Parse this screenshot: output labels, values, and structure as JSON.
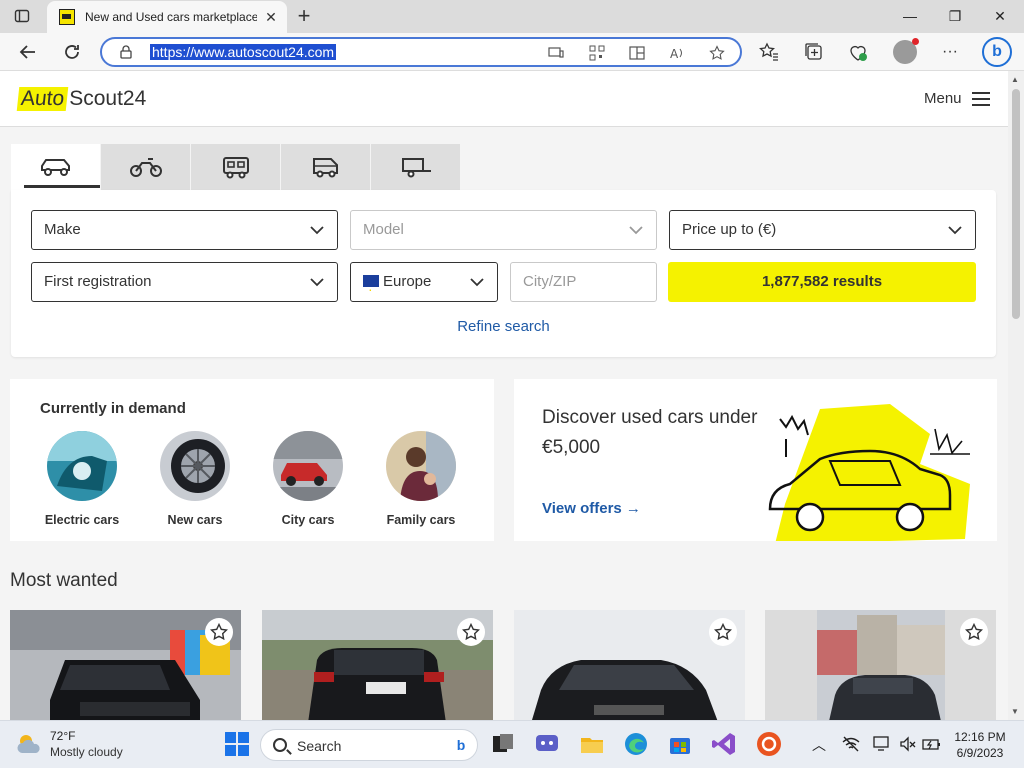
{
  "browser": {
    "tab_title": "New and Used cars marketplace",
    "url": "https://www.autoscout24.com",
    "close_tab": "✕",
    "new_tab": "+",
    "window_controls": {
      "minimize": "—",
      "maximize": "❐",
      "close": "✕"
    },
    "icons": [
      "tab-actions-icon",
      "back-icon",
      "refresh-icon",
      "lock-icon",
      "app-available-icon",
      "qr-code-icon",
      "split-screen-icon",
      "read-aloud-icon",
      "favorite-star-icon",
      "favorites-icon",
      "collections-icon",
      "browser-essentials-icon",
      "profile-icon",
      "more-icon",
      "bing-chat-icon"
    ]
  },
  "site": {
    "logo_auto": "Auto",
    "logo_rest": "Scout24",
    "menu_label": "Menu",
    "vehicle_tabs": [
      "car-icon",
      "motorbike-icon",
      "camper-icon",
      "van-icon",
      "trailer-icon"
    ],
    "search": {
      "make": "Make",
      "model": "Model",
      "price": "Price up to (€)",
      "first_registration": "First registration",
      "country": "Europe",
      "city_placeholder": "City/ZIP",
      "results_button": "1,877,582 results",
      "refine": "Refine search"
    },
    "demand": {
      "title": "Currently in demand",
      "items": [
        {
          "label": "Electric cars"
        },
        {
          "label": "New cars"
        },
        {
          "label": "City cars"
        },
        {
          "label": "Family cars"
        }
      ]
    },
    "promo": {
      "title": "Discover used cars under €5,000",
      "link": "View offers →"
    },
    "most_wanted": {
      "title": "Most wanted"
    }
  },
  "taskbar": {
    "temperature": "72°F",
    "weather": "Mostly cloudy",
    "search_label": "Search",
    "time": "12:16 PM",
    "date": "6/9/2023"
  },
  "colors": {
    "brand_yellow": "#f5f200",
    "link_blue": "#1f5aa6",
    "edge_blue": "#1f6fd6"
  }
}
